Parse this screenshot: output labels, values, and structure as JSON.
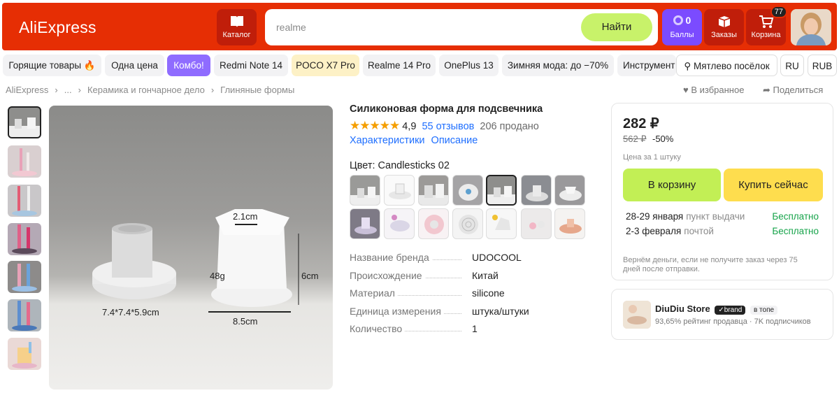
{
  "header": {
    "logo": "AliExpress",
    "catalog_label": "Каталог",
    "search_placeholder": "realme",
    "search_button": "Найти",
    "points_value": "0",
    "points_label": "Баллы",
    "orders_label": "Заказы",
    "cart_label": "Корзина",
    "cart_count": "77"
  },
  "categories": [
    {
      "label": "Горящие товары 🔥"
    },
    {
      "label": "Одна цена"
    },
    {
      "label": "Комбо!"
    },
    {
      "label": "Redmi Note 14"
    },
    {
      "label": "POCO X7 Pro"
    },
    {
      "label": "Realme 14 Pro"
    },
    {
      "label": "OnePlus 13"
    },
    {
      "label": "Зимняя мода: до −70%"
    },
    {
      "label": "Инструмент"
    }
  ],
  "location": "Мятлево посёлок",
  "language": "RU",
  "currency": "RUB",
  "breadcrumb": [
    "AliExpress",
    "...",
    "Керамика и гончарное дело",
    "Глиняные формы"
  ],
  "actions": {
    "favorite": "В избранное",
    "share": "Поделиться"
  },
  "image_labels": {
    "top": "2.1cm",
    "weight": "48g",
    "height": "6cm",
    "size": "7.4*7.4*5.9cm",
    "width": "8.5cm"
  },
  "product": {
    "title": "Силиконовая форма для подсвечника",
    "stars": "★★★★★",
    "rating": "4,9",
    "reviews": "55 отзывов",
    "sold": "206 продано",
    "link_specs": "Характеристики",
    "link_desc": "Описание",
    "color_label": "Цвет: Candlesticks 02"
  },
  "specs": [
    {
      "key": "Название бренда",
      "value": "UDOCOOL"
    },
    {
      "key": "Происхождение",
      "value": "Китай"
    },
    {
      "key": "Материал",
      "value": "silicone"
    },
    {
      "key": "Единица измерения",
      "value": "штука/штуки"
    },
    {
      "key": "Количество",
      "value": "1"
    }
  ],
  "buybox": {
    "price": "282 ₽",
    "old_price": "562 ₽",
    "discount": "-50%",
    "per_unit": "Цена за 1 штуку",
    "cart_button": "В корзину",
    "buy_button": "Купить сейчас",
    "delivery": [
      {
        "date": "28-29 января",
        "method": "пункт выдачи",
        "price": "Бесплатно"
      },
      {
        "date": "2-3 февраля",
        "method": "почтой",
        "price": "Бесплатно"
      }
    ],
    "note": "Вернём деньги, если не получите заказ через 75 дней после отправки."
  },
  "store": {
    "name": "DiuDiu Store",
    "brand_badge": "brand",
    "top_badge": "в топе",
    "meta": "93,65% рейтинг продавца · 7K подписчиков"
  },
  "colors": {
    "brand_red": "#e62e04",
    "cart_green": "#c2ef55",
    "buy_yellow": "#fedd4e",
    "link_blue": "#1f6fff",
    "free_green": "#16a34a"
  }
}
